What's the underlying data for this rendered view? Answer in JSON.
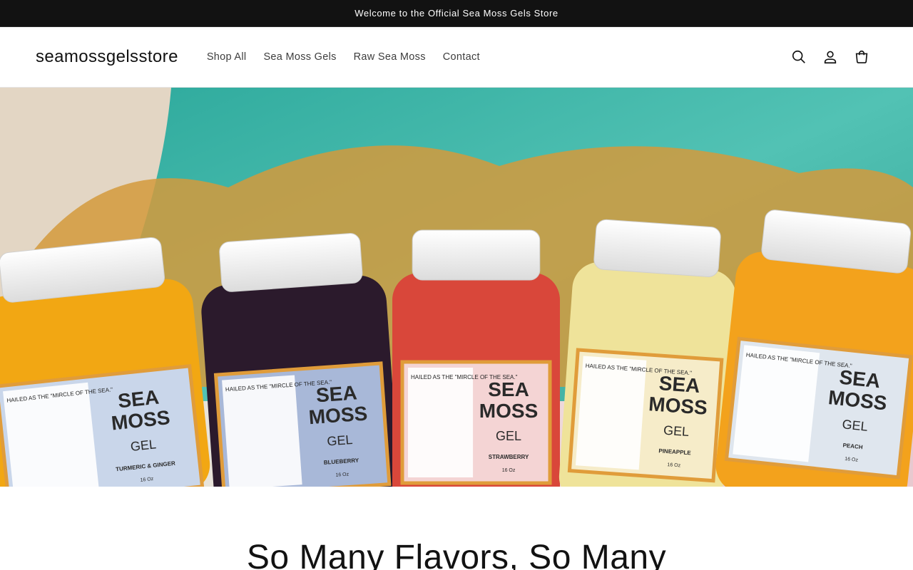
{
  "announcement": {
    "text": "Welcome to the Official Sea Moss Gels Store"
  },
  "header": {
    "logo": "seamossgelsstore",
    "nav": [
      {
        "label": "Shop All"
      },
      {
        "label": "Sea Moss Gels"
      },
      {
        "label": "Raw Sea Moss"
      },
      {
        "label": "Contact"
      }
    ],
    "icons": {
      "search": "search-icon",
      "account": "account-icon",
      "cart": "cart-icon"
    }
  },
  "hero": {
    "jars": [
      {
        "title": "SEA\nMOSS",
        "gel": "GEL",
        "flavor": "TURMERIC & GINGER",
        "size": "16 Oz",
        "tagline": "HAILED AS THE \"MIRCLE OF THE SEA.\"",
        "fill": "#f2a713",
        "label_bg": "#c9d6ea"
      },
      {
        "title": "SEA\nMOSS",
        "gel": "GEL",
        "flavor": "BLUEBERRY",
        "size": "16 Oz",
        "tagline": "HAILED AS THE \"MIRCLE OF THE SEA.\"",
        "fill": "#2b1a2c",
        "label_bg": "#a8b8d8"
      },
      {
        "title": "SEA\nMOSS",
        "gel": "GEL",
        "flavor": "STRAWBERRY",
        "size": "16 Oz",
        "tagline": "HAILED AS THE \"MIRCLE OF THE SEA.\"",
        "fill": "#d9473a",
        "label_bg": "#f4d4d4"
      },
      {
        "title": "SEA\nMOSS",
        "gel": "GEL",
        "flavor": "PINEAPPLE",
        "size": "16 Oz",
        "tagline": "HAILED AS THE \"MIRCLE OF THE SEA.\"",
        "fill": "#efe39a",
        "label_bg": "#f6ecc9"
      },
      {
        "title": "SEA\nMOSS",
        "gel": "GEL",
        "flavor": "PEACH",
        "size": "16 Oz",
        "tagline": "HAILED AS THE \"MIRCLE OF THE SEA.\"",
        "fill": "#f3a21c",
        "label_bg": "#dfe6ee"
      }
    ]
  },
  "section": {
    "heading": "So Many Flavors, So Many"
  },
  "colors": {
    "announcement_bg": "#121212",
    "pool": "#3fb4a8",
    "moss": "#d9a24a"
  }
}
